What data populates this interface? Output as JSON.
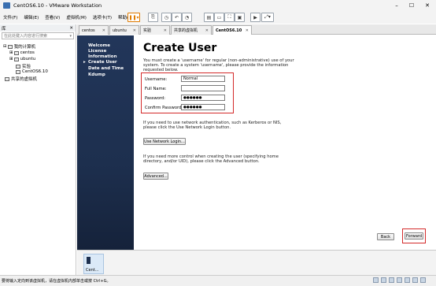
{
  "window": {
    "title": "CentOS6.10 - VMware Workstation"
  },
  "menubar": {
    "items": [
      "文件(F)",
      "编辑(E)",
      "查看(V)",
      "虚拟机(M)",
      "选项卡(T)",
      "帮助(H)"
    ]
  },
  "tabs": [
    {
      "label": "centos"
    },
    {
      "label": "ubuntu"
    },
    {
      "label": "实验"
    },
    {
      "label": "共享的虚拟机"
    },
    {
      "label": "CentOS6.10"
    }
  ],
  "library": {
    "title": "库",
    "search_placeholder": "在此处键入内容进行搜索",
    "tree": {
      "my_computer": "我的计算机",
      "items": [
        "centos",
        "ubuntu",
        "实验",
        "CentOS6.10"
      ],
      "shared": "共享的虚拟机"
    }
  },
  "installer": {
    "steps": [
      "Welcome",
      "License Information",
      "Create User",
      "Date and Time",
      "Kdump"
    ],
    "current_step": "Create User",
    "heading": "Create User",
    "intro": [
      "You must create a 'username' for regular (non-administrative) use of your",
      "system.  To create a system 'username', please provide the information",
      "requested below."
    ],
    "fields": {
      "username": {
        "label": "Username:",
        "value": "Normal"
      },
      "fullname": {
        "label": "Full Name:",
        "value": ""
      },
      "password": {
        "label": "Password:",
        "value": "●●●●●●"
      },
      "confirm": {
        "label": "Confirm Password:",
        "value": "●●●●●●"
      }
    },
    "network_text": [
      "If you need to use network authentication, such as Kerberos or NIS,",
      "please click the Use Network Login button."
    ],
    "network_button": "Use Network Login...",
    "advanced_text": [
      "If you need more control when creating the user (specifying home",
      "directory, and/or UID), please click the Advanced button."
    ],
    "advanced_button": "Advanced...",
    "back_button": "Back",
    "forward_button": "Forward"
  },
  "thumbnail": {
    "label": "Cent..."
  },
  "statusbar": {
    "text": "要将输入定向到该虚拟机，请在虚拟机内部单击或按 Ctrl+G。"
  }
}
